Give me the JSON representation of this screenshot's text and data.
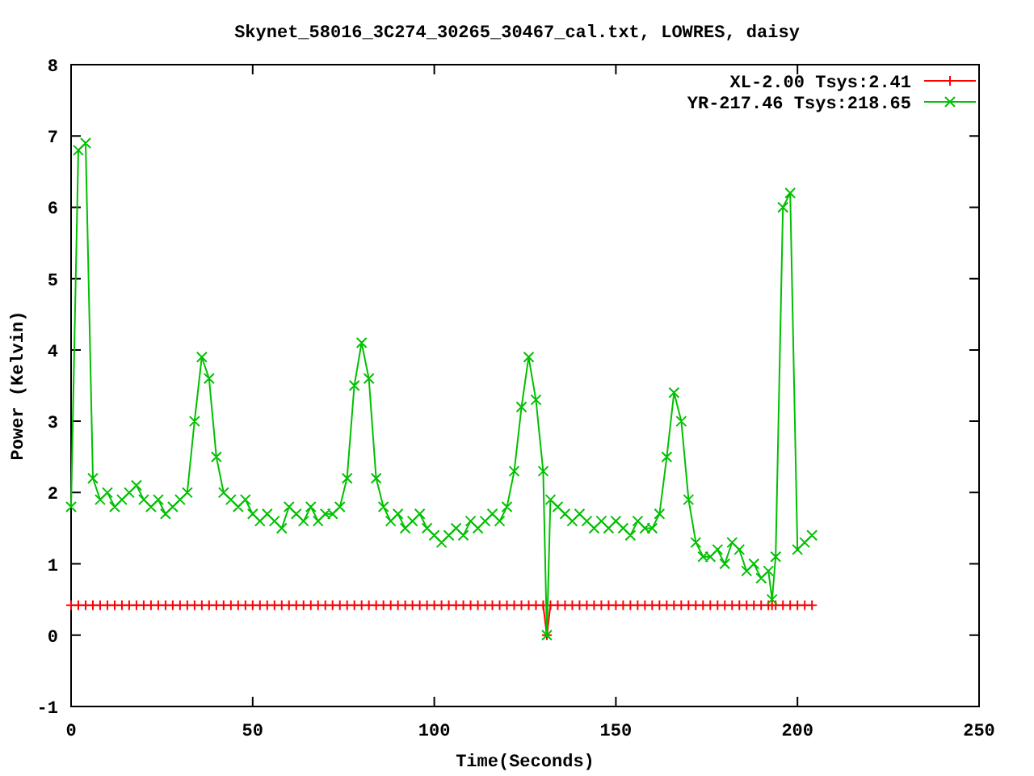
{
  "chart": {
    "chart_data": {
      "type": "line",
      "title": "Skynet_58016_3C274_30265_30467_cal.txt, LOWRES, daisy",
      "xlabel": "Time(Seconds)",
      "ylabel": "Power (Kelvin)",
      "xlim": [
        0,
        250
      ],
      "ylim": [
        -1,
        8
      ],
      "xticks": [
        0,
        50,
        100,
        150,
        200,
        250
      ],
      "yticks": [
        -1,
        0,
        1,
        2,
        3,
        4,
        5,
        6,
        7,
        8
      ],
      "legend": true,
      "x": [
        0,
        2,
        4,
        6,
        8,
        10,
        12,
        14,
        16,
        18,
        20,
        22,
        24,
        26,
        28,
        30,
        32,
        34,
        36,
        38,
        40,
        42,
        44,
        46,
        48,
        50,
        52,
        54,
        56,
        58,
        60,
        62,
        64,
        66,
        68,
        70,
        72,
        74,
        76,
        78,
        80,
        82,
        84,
        86,
        88,
        90,
        92,
        94,
        96,
        98,
        100,
        102,
        104,
        106,
        108,
        110,
        112,
        114,
        116,
        118,
        120,
        122,
        124,
        126,
        128,
        130,
        131,
        132,
        134,
        136,
        138,
        140,
        142,
        144,
        146,
        148,
        150,
        152,
        154,
        156,
        158,
        160,
        162,
        164,
        166,
        168,
        170,
        172,
        174,
        176,
        178,
        180,
        182,
        184,
        186,
        188,
        190,
        192,
        193,
        194,
        196,
        198,
        200,
        202,
        204
      ],
      "series": [
        {
          "name": "XL-2.00 Tsys:2.41",
          "color": "#ff0000",
          "marker": "plus",
          "values": [
            0.42,
            0.42,
            0.42,
            0.42,
            0.42,
            0.42,
            0.42,
            0.42,
            0.42,
            0.42,
            0.42,
            0.42,
            0.42,
            0.42,
            0.42,
            0.42,
            0.42,
            0.42,
            0.42,
            0.42,
            0.42,
            0.42,
            0.42,
            0.42,
            0.42,
            0.42,
            0.42,
            0.42,
            0.42,
            0.42,
            0.42,
            0.42,
            0.42,
            0.42,
            0.42,
            0.42,
            0.42,
            0.42,
            0.42,
            0.42,
            0.42,
            0.42,
            0.42,
            0.42,
            0.42,
            0.42,
            0.42,
            0.42,
            0.42,
            0.42,
            0.42,
            0.42,
            0.42,
            0.42,
            0.42,
            0.42,
            0.42,
            0.42,
            0.42,
            0.42,
            0.42,
            0.42,
            0.42,
            0.42,
            0.42,
            0.42,
            0.0,
            0.42,
            0.42,
            0.42,
            0.42,
            0.42,
            0.42,
            0.42,
            0.42,
            0.42,
            0.42,
            0.42,
            0.42,
            0.42,
            0.42,
            0.42,
            0.42,
            0.42,
            0.42,
            0.42,
            0.42,
            0.42,
            0.42,
            0.42,
            0.42,
            0.42,
            0.42,
            0.42,
            0.42,
            0.42,
            0.42,
            0.42,
            0.42,
            0.42,
            0.42,
            0.42,
            0.42,
            0.42,
            0.42
          ]
        },
        {
          "name": "YR-217.46 Tsys:218.65",
          "color": "#00c000",
          "marker": "cross",
          "values": [
            1.8,
            6.8,
            6.9,
            2.2,
            1.9,
            2.0,
            1.8,
            1.9,
            2.0,
            2.1,
            1.9,
            1.8,
            1.9,
            1.7,
            1.8,
            1.9,
            2.0,
            3.0,
            3.9,
            3.6,
            2.5,
            2.0,
            1.9,
            1.8,
            1.9,
            1.7,
            1.6,
            1.7,
            1.6,
            1.5,
            1.8,
            1.7,
            1.6,
            1.8,
            1.6,
            1.7,
            1.7,
            1.8,
            2.2,
            3.5,
            4.1,
            3.6,
            2.2,
            1.8,
            1.6,
            1.7,
            1.5,
            1.6,
            1.7,
            1.5,
            1.4,
            1.3,
            1.4,
            1.5,
            1.4,
            1.6,
            1.5,
            1.6,
            1.7,
            1.6,
            1.8,
            2.3,
            3.2,
            3.9,
            3.3,
            2.3,
            0.0,
            1.9,
            1.8,
            1.7,
            1.6,
            1.7,
            1.6,
            1.5,
            1.6,
            1.5,
            1.6,
            1.5,
            1.4,
            1.6,
            1.5,
            1.5,
            1.7,
            2.5,
            3.4,
            3.0,
            1.9,
            1.3,
            1.1,
            1.1,
            1.2,
            1.0,
            1.3,
            1.2,
            0.9,
            1.0,
            0.8,
            0.9,
            0.5,
            1.1,
            6.0,
            6.2,
            1.2,
            1.3,
            1.4
          ]
        }
      ]
    }
  }
}
